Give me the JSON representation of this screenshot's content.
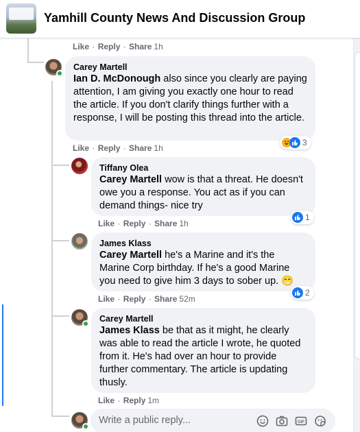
{
  "header": {
    "group_name": "Yamhill County News And Discussion Group"
  },
  "prev_actions": {
    "like": "Like",
    "reply": "Reply",
    "share": "Share",
    "time": "1h"
  },
  "comments": [
    {
      "author": "Carey Martell",
      "mention": "Ian D. McDonough",
      "text": " also since you clearly are paying attention, I am giving you exactly one hour to read the article. If you don't clarify things further with a response, I will be posting this thread into the article.",
      "actions": {
        "like": "Like",
        "reply": "Reply",
        "share": "Share",
        "time": "1h"
      },
      "reaction_count": "3"
    },
    {
      "author": "Tiffany Olea",
      "mention": "Carey Martell",
      "text": " wow is that a threat. He doesn't owe you a response. You act as if you can demand things- nice try",
      "actions": {
        "like": "Like",
        "reply": "Reply",
        "share": "Share",
        "time": "1h"
      },
      "reaction_count": "1"
    },
    {
      "author": "James Klass",
      "mention": "Carey Martell",
      "text": " he's a Marine and it's the Marine Corp birthday. If he's a good Marine you need to give him 3 days to sober up. 😁",
      "actions": {
        "like": "Like",
        "reply": "Reply",
        "share": "Share",
        "time": "52m"
      },
      "reaction_count": "2"
    },
    {
      "author": "Carey Martell",
      "mention": "James Klass",
      "text": " be that as it might, he clearly was able to read the article I wrote, he quoted from it. He's had over an hour to provide further commentary. The article is updating thusly.",
      "actions": {
        "like": "Like",
        "reply": "Reply",
        "time": "1m"
      }
    }
  ],
  "reply_box": {
    "placeholder": "Write a public reply..."
  },
  "icons": {
    "emoji": "smiley-icon",
    "camera": "camera-icon",
    "gif": "gif-icon",
    "sticker": "sticker-icon",
    "like": "like-reaction-icon",
    "haha": "haha-reaction-icon"
  },
  "colors": {
    "accent": "#1877f2",
    "bubble": "#f0f2f5",
    "secondary_text": "#65676b"
  }
}
